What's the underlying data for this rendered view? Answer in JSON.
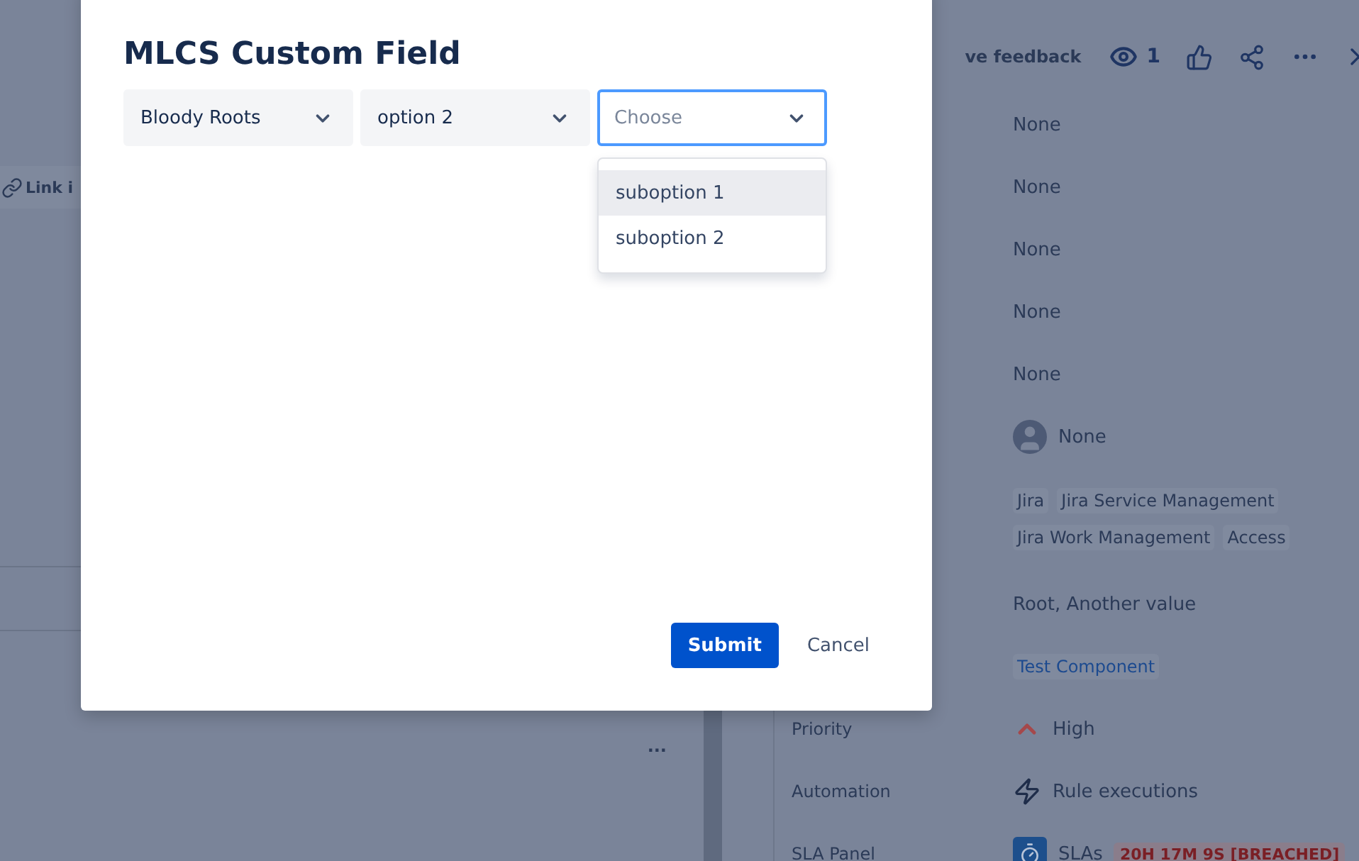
{
  "background": {
    "link_button": "Link i",
    "more_button": "...",
    "header": {
      "feedback": "ve feedback",
      "watchers": "1"
    },
    "fields": [
      {
        "kind": "text",
        "value": "None"
      },
      {
        "kind": "text",
        "value": "None"
      },
      {
        "kind": "text",
        "value": "None"
      },
      {
        "kind": "text",
        "value": "None"
      },
      {
        "kind": "text",
        "value": "None"
      },
      {
        "kind": "user",
        "value": "None"
      },
      {
        "kind": "tags",
        "tags": [
          "Jira",
          "Jira Service Management",
          "Jira Work Management",
          "Access"
        ]
      },
      {
        "kind": "text",
        "value": "Root, Another value"
      },
      {
        "kind": "component",
        "value": "Test Component"
      },
      {
        "kind": "priority",
        "label": "Priority",
        "value": "High"
      },
      {
        "kind": "automation",
        "label": "Automation",
        "value": "Rule executions"
      },
      {
        "kind": "sla",
        "label": "SLA Panel",
        "value": "SLAs",
        "badge": "20H 17M 9S [BREACHED]"
      }
    ]
  },
  "dialog": {
    "title": "MLCS Custom Field",
    "selects": [
      {
        "value": "Bloody Roots",
        "focused": false
      },
      {
        "value": "option 2",
        "focused": false
      },
      {
        "placeholder": "Choose",
        "focused": true
      }
    ],
    "menu": [
      {
        "label": "suboption 1",
        "highlighted": true
      },
      {
        "label": "suboption 2",
        "highlighted": false
      }
    ],
    "buttons": [
      {
        "kind": "primary",
        "label": "Submit"
      },
      {
        "kind": "subtle",
        "label": "Cancel"
      }
    ]
  }
}
